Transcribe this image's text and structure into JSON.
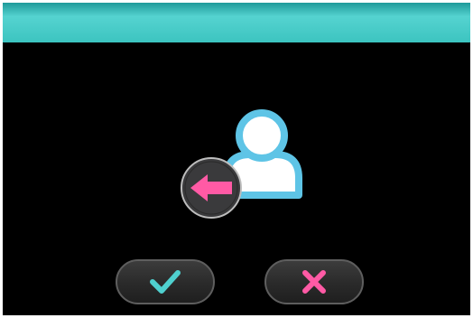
{
  "colors": {
    "title_bar_top": "#1f9a9a",
    "title_bar_middle": "#55d3d0",
    "title_bar_bottom": "#3cc4c0",
    "background": "#000000",
    "user_outline": "#5ec4e6",
    "user_fill": "#ffffff",
    "arrow": "#ff5aa5",
    "arrow_badge": "#3a3a3c",
    "button_face": "#2e2e2e",
    "button_border": "#5e5e5e",
    "confirm_icon": "#4fd0cf",
    "cancel_icon": "#ff5aa5"
  },
  "illustration": {
    "icon": "user-icon",
    "badge_icon": "arrow-left-icon"
  },
  "buttons": {
    "confirm": {
      "icon": "checkmark-icon"
    },
    "cancel": {
      "icon": "close-icon"
    }
  }
}
